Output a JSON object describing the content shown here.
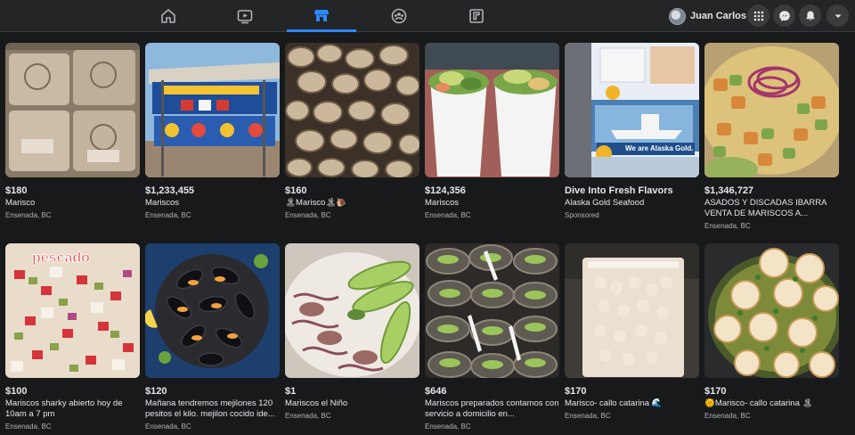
{
  "nav": {
    "tabs": [
      {
        "name": "home",
        "icon": "home-icon"
      },
      {
        "name": "watch",
        "icon": "video-icon"
      },
      {
        "name": "marketplace",
        "icon": "marketplace-icon"
      },
      {
        "name": "groups",
        "icon": "groups-icon"
      },
      {
        "name": "gaming",
        "icon": "gaming-icon"
      }
    ],
    "active_tab": "marketplace",
    "user_name": "Juan Carlos",
    "actions": [
      "menu-grid-icon",
      "messenger-icon",
      "notifications-icon",
      "account-caret-icon"
    ]
  },
  "colors": {
    "background": "#18191a",
    "bar": "#242526",
    "accent": "#2d88ff",
    "muted": "#b0b3b8"
  },
  "listings": [
    {
      "price": "$180",
      "title": "Marisco",
      "location": "Ensenada, BC"
    },
    {
      "price": "$1,233,455",
      "title": "Mariscos",
      "location": "Ensenada, BC"
    },
    {
      "price": "$160",
      "title": "🏝Marisco🏝🐌",
      "location": "Ensenada, BC"
    },
    {
      "price": "$124,356",
      "title": "Mariscos",
      "location": "Ensenada, BC"
    },
    {
      "price": "Dive Into Fresh Flavors",
      "title": "Alaska Gold Seafood",
      "location": "Sponsored",
      "image_text": "We are Alaska Gold."
    },
    {
      "price": "$1,346,727",
      "title": "ASADOS Y DISCADAS IBARRA VENTA DE MARISCOS A...",
      "location": "Ensenada, BC"
    },
    {
      "price": "$100",
      "title": "Mariscos sharky abierto hoy de 10am a 7 pm",
      "location": "Ensenada, BC",
      "image_text": "pescado"
    },
    {
      "price": "$120",
      "title": "Mañana tendremos mejilones 120 pesitos el kilo. mejilon cocido ide...",
      "location": "Ensenada, BC"
    },
    {
      "price": "$1",
      "title": "Mariscos el Niño",
      "location": "Ensenada, BC"
    },
    {
      "price": "$646",
      "title": "Mariscos preparados contamos con servicio a domicilio en...",
      "location": "Ensenada, BC"
    },
    {
      "price": "$170",
      "title": "Marisco- callo catarina 🌊",
      "location": "Ensenada, BC"
    },
    {
      "price": "$170",
      "title": "🌞Marisco- callo catarina 🏝",
      "location": "Ensenada, BC"
    }
  ]
}
